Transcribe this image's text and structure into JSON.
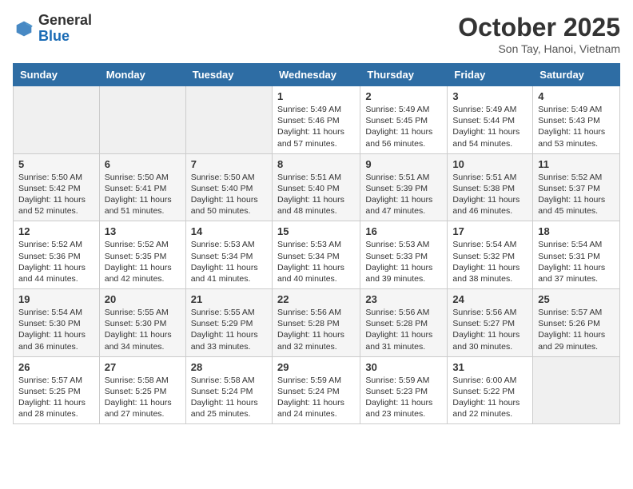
{
  "logo": {
    "general": "General",
    "blue": "Blue"
  },
  "title": "October 2025",
  "location": "Son Tay, Hanoi, Vietnam",
  "days_of_week": [
    "Sunday",
    "Monday",
    "Tuesday",
    "Wednesday",
    "Thursday",
    "Friday",
    "Saturday"
  ],
  "weeks": [
    [
      {
        "day": "",
        "info": ""
      },
      {
        "day": "",
        "info": ""
      },
      {
        "day": "",
        "info": ""
      },
      {
        "day": "1",
        "info": "Sunrise: 5:49 AM\nSunset: 5:46 PM\nDaylight: 11 hours and 57 minutes."
      },
      {
        "day": "2",
        "info": "Sunrise: 5:49 AM\nSunset: 5:45 PM\nDaylight: 11 hours and 56 minutes."
      },
      {
        "day": "3",
        "info": "Sunrise: 5:49 AM\nSunset: 5:44 PM\nDaylight: 11 hours and 54 minutes."
      },
      {
        "day": "4",
        "info": "Sunrise: 5:49 AM\nSunset: 5:43 PM\nDaylight: 11 hours and 53 minutes."
      }
    ],
    [
      {
        "day": "5",
        "info": "Sunrise: 5:50 AM\nSunset: 5:42 PM\nDaylight: 11 hours and 52 minutes."
      },
      {
        "day": "6",
        "info": "Sunrise: 5:50 AM\nSunset: 5:41 PM\nDaylight: 11 hours and 51 minutes."
      },
      {
        "day": "7",
        "info": "Sunrise: 5:50 AM\nSunset: 5:40 PM\nDaylight: 11 hours and 50 minutes."
      },
      {
        "day": "8",
        "info": "Sunrise: 5:51 AM\nSunset: 5:40 PM\nDaylight: 11 hours and 48 minutes."
      },
      {
        "day": "9",
        "info": "Sunrise: 5:51 AM\nSunset: 5:39 PM\nDaylight: 11 hours and 47 minutes."
      },
      {
        "day": "10",
        "info": "Sunrise: 5:51 AM\nSunset: 5:38 PM\nDaylight: 11 hours and 46 minutes."
      },
      {
        "day": "11",
        "info": "Sunrise: 5:52 AM\nSunset: 5:37 PM\nDaylight: 11 hours and 45 minutes."
      }
    ],
    [
      {
        "day": "12",
        "info": "Sunrise: 5:52 AM\nSunset: 5:36 PM\nDaylight: 11 hours and 44 minutes."
      },
      {
        "day": "13",
        "info": "Sunrise: 5:52 AM\nSunset: 5:35 PM\nDaylight: 11 hours and 42 minutes."
      },
      {
        "day": "14",
        "info": "Sunrise: 5:53 AM\nSunset: 5:34 PM\nDaylight: 11 hours and 41 minutes."
      },
      {
        "day": "15",
        "info": "Sunrise: 5:53 AM\nSunset: 5:34 PM\nDaylight: 11 hours and 40 minutes."
      },
      {
        "day": "16",
        "info": "Sunrise: 5:53 AM\nSunset: 5:33 PM\nDaylight: 11 hours and 39 minutes."
      },
      {
        "day": "17",
        "info": "Sunrise: 5:54 AM\nSunset: 5:32 PM\nDaylight: 11 hours and 38 minutes."
      },
      {
        "day": "18",
        "info": "Sunrise: 5:54 AM\nSunset: 5:31 PM\nDaylight: 11 hours and 37 minutes."
      }
    ],
    [
      {
        "day": "19",
        "info": "Sunrise: 5:54 AM\nSunset: 5:30 PM\nDaylight: 11 hours and 36 minutes."
      },
      {
        "day": "20",
        "info": "Sunrise: 5:55 AM\nSunset: 5:30 PM\nDaylight: 11 hours and 34 minutes."
      },
      {
        "day": "21",
        "info": "Sunrise: 5:55 AM\nSunset: 5:29 PM\nDaylight: 11 hours and 33 minutes."
      },
      {
        "day": "22",
        "info": "Sunrise: 5:56 AM\nSunset: 5:28 PM\nDaylight: 11 hours and 32 minutes."
      },
      {
        "day": "23",
        "info": "Sunrise: 5:56 AM\nSunset: 5:28 PM\nDaylight: 11 hours and 31 minutes."
      },
      {
        "day": "24",
        "info": "Sunrise: 5:56 AM\nSunset: 5:27 PM\nDaylight: 11 hours and 30 minutes."
      },
      {
        "day": "25",
        "info": "Sunrise: 5:57 AM\nSunset: 5:26 PM\nDaylight: 11 hours and 29 minutes."
      }
    ],
    [
      {
        "day": "26",
        "info": "Sunrise: 5:57 AM\nSunset: 5:25 PM\nDaylight: 11 hours and 28 minutes."
      },
      {
        "day": "27",
        "info": "Sunrise: 5:58 AM\nSunset: 5:25 PM\nDaylight: 11 hours and 27 minutes."
      },
      {
        "day": "28",
        "info": "Sunrise: 5:58 AM\nSunset: 5:24 PM\nDaylight: 11 hours and 25 minutes."
      },
      {
        "day": "29",
        "info": "Sunrise: 5:59 AM\nSunset: 5:24 PM\nDaylight: 11 hours and 24 minutes."
      },
      {
        "day": "30",
        "info": "Sunrise: 5:59 AM\nSunset: 5:23 PM\nDaylight: 11 hours and 23 minutes."
      },
      {
        "day": "31",
        "info": "Sunrise: 6:00 AM\nSunset: 5:22 PM\nDaylight: 11 hours and 22 minutes."
      },
      {
        "day": "",
        "info": ""
      }
    ]
  ]
}
